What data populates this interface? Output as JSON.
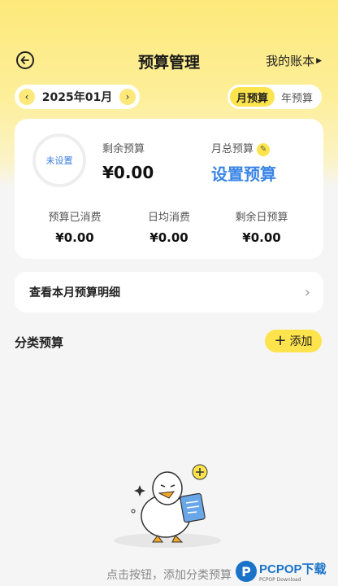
{
  "header": {
    "title": "预算管理",
    "account_label": "我的账本"
  },
  "period": {
    "prev": "‹",
    "month": "2025年01月",
    "next": "›",
    "tabs": [
      {
        "label": "月预算",
        "active": true
      },
      {
        "label": "年预算",
        "active": false
      }
    ]
  },
  "summary": {
    "ring_label": "未设置",
    "remaining_label": "剩余预算",
    "remaining_value": "¥0.00",
    "monthly_total_label": "月总预算",
    "set_budget_label": "设置预算",
    "stats": [
      {
        "label": "预算已消费",
        "value": "¥0.00"
      },
      {
        "label": "日均消费",
        "value": "¥0.00"
      },
      {
        "label": "剩余日预算",
        "value": "¥0.00"
      }
    ]
  },
  "detail_row": {
    "label": "查看本月预算明细"
  },
  "category": {
    "title": "分类预算",
    "add_label": "添加"
  },
  "empty_state": {
    "hint": "点击按钮，添加分类预算"
  },
  "watermark": {
    "text": "PCPOP下载",
    "sub": "PCPOP Download"
  },
  "colors": {
    "accent_yellow": "#fde34c",
    "link_blue": "#3a85e6",
    "background": "#f5f5f5"
  }
}
